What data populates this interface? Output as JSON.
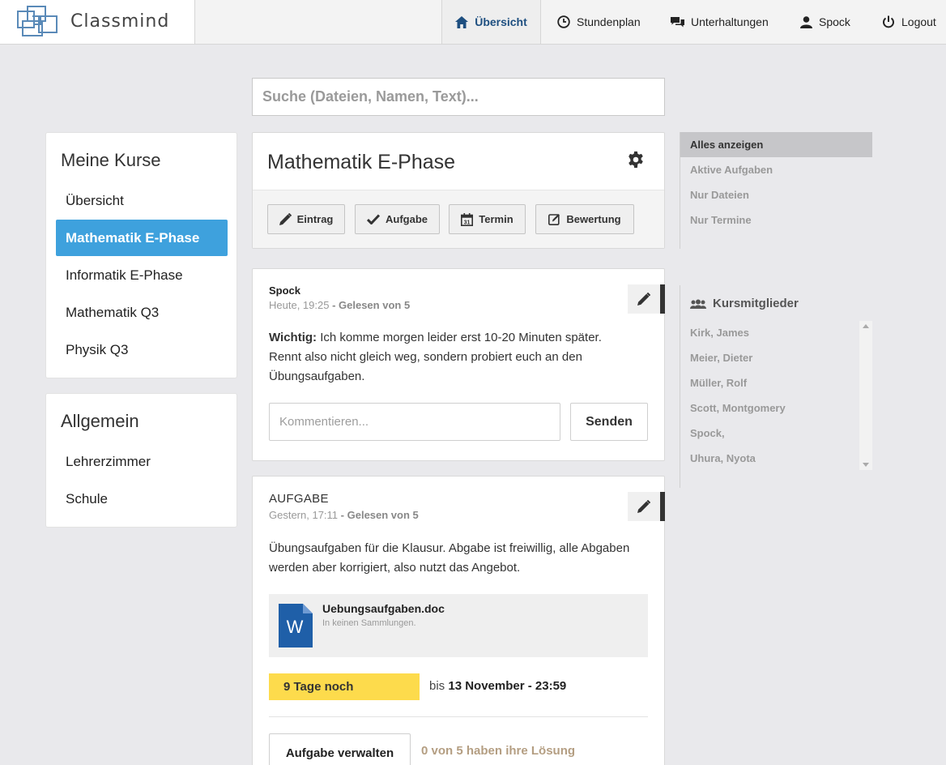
{
  "brand": {
    "name": "Classmind",
    "logo_icon": "maze-logo-icon"
  },
  "nav": {
    "items": [
      {
        "label": "Übersicht",
        "icon": "home-icon",
        "active": true
      },
      {
        "label": "Stundenplan",
        "icon": "clock-icon"
      },
      {
        "label": "Unterhaltungen",
        "icon": "chat-icon"
      },
      {
        "label": "Spock",
        "icon": "user-icon"
      },
      {
        "label": "Logout",
        "icon": "power-icon"
      }
    ]
  },
  "search": {
    "placeholder": "Suche (Dateien, Namen, Text)..."
  },
  "sidebar": {
    "courses_title": "Meine Kurse",
    "courses": [
      {
        "label": "Übersicht"
      },
      {
        "label": "Mathematik E-Phase",
        "active": true
      },
      {
        "label": "Informatik E-Phase"
      },
      {
        "label": "Mathematik Q3"
      },
      {
        "label": "Physik Q3"
      }
    ],
    "general_title": "Allgemein",
    "general": [
      {
        "label": "Lehrerzimmer"
      },
      {
        "label": "Schule"
      }
    ]
  },
  "course": {
    "title": "Mathematik E-Phase",
    "actions": [
      {
        "label": "Eintrag",
        "icon": "pencil-icon"
      },
      {
        "label": "Aufgabe",
        "icon": "check-icon"
      },
      {
        "label": "Termin",
        "icon": "calendar-icon"
      },
      {
        "label": "Bewertung",
        "icon": "edit-square-icon"
      }
    ]
  },
  "posts": [
    {
      "author": "Spock",
      "time": "Heute, 19:25",
      "read": "- Gelesen von 5",
      "body_strong": "Wichtig:",
      "body": " Ich komme morgen leider erst 10-20 Minuten später. Rennt also nicht gleich weg, sondern probiert euch an den Übungsaufgaben.",
      "comment_placeholder": "Kommentieren...",
      "send_label": "Senden"
    },
    {
      "type": "AUFGABE",
      "time": "Gestern, 17:11",
      "read": "- Gelesen von 5",
      "body": "Übungsaufgaben für die Klausur. Abgabe ist freiwillig, alle Abgaben werden aber korrigiert, also nutzt das Angebot.",
      "file": {
        "name": "Uebungsaufgaben.doc",
        "sub": "In keinen Sammlungen.",
        "icon_letter": "W"
      },
      "deadline_badge": "9 Tage noch",
      "deadline_prefix": "bis",
      "deadline_date": "13 November - 23:59",
      "manage_label": "Aufgabe verwalten",
      "status": "0 von 5 haben ihre Lösung"
    }
  ],
  "filters": [
    {
      "label": "Alles anzeigen",
      "active": true
    },
    {
      "label": "Aktive Aufgaben"
    },
    {
      "label": "Nur Dateien"
    },
    {
      "label": "Nur Termine"
    }
  ],
  "members": {
    "title": "Kursmitglieder",
    "list": [
      "Kirk, James",
      "Meier, Dieter",
      "Müller, Rolf",
      "Scott, Montgomery",
      "Spock,",
      "Uhura, Nyota"
    ]
  },
  "colors": {
    "accent": "#3ea1dd",
    "deadline": "#fddb4c",
    "nav_active": "#1e4f80",
    "word_blue": "#1f5fa8"
  }
}
